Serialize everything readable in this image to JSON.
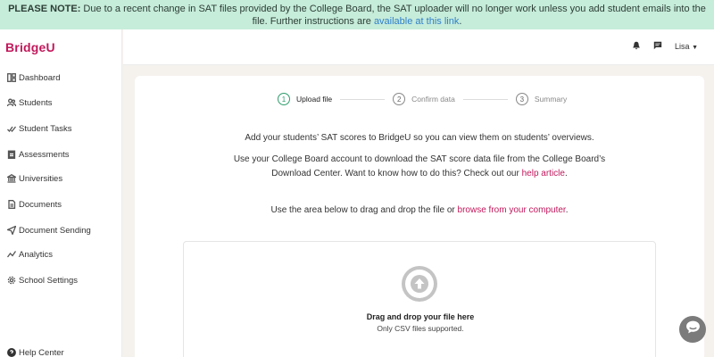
{
  "notice": {
    "label": "PLEASE NOTE:",
    "text": " Due to a recent change in SAT files provided by the College Board, the SAT uploader will no longer work unless you add student emails into the file. Further instructions are ",
    "link": "available at this link",
    "end": "."
  },
  "brand": {
    "logo": "BridgeU",
    "color": "#c2185b"
  },
  "sidebar": {
    "items": [
      {
        "label": "Dashboard",
        "icon": "dashboard-icon"
      },
      {
        "label": "Students",
        "icon": "users-icon"
      },
      {
        "label": "Student Tasks",
        "icon": "check-icon"
      },
      {
        "label": "Assessments",
        "icon": "clipboard-icon"
      },
      {
        "label": "Universities",
        "icon": "university-icon"
      },
      {
        "label": "Documents",
        "icon": "document-icon"
      },
      {
        "label": "Document Sending",
        "icon": "send-icon"
      },
      {
        "label": "Analytics",
        "icon": "analytics-icon"
      },
      {
        "label": "School Settings",
        "icon": "gear-icon"
      }
    ],
    "help": "Help Center"
  },
  "topbar": {
    "user": "Lisa"
  },
  "steps": [
    {
      "num": "1",
      "label": "Upload file",
      "active": true
    },
    {
      "num": "2",
      "label": "Confirm data",
      "active": false
    },
    {
      "num": "3",
      "label": "Summary",
      "active": false
    }
  ],
  "copy": {
    "line1": "Add your students’ SAT scores to BridgeU so you can view them on students’ overviews.",
    "line2a": "Use your College Board account to download the SAT score data file from the College Board’s Download Center. Want to know how to do this? Check out our ",
    "line2_link": "help article",
    "line2_end": ".",
    "line3a": "Use the area below to drag and drop the file or ",
    "line3_link": "browse from your computer",
    "line3_end": "."
  },
  "dropzone": {
    "title": "Drag and drop your file here",
    "sub": "Only CSV files supported."
  },
  "colors": {
    "accent": "#c2185b",
    "active_step": "#2e9d6c",
    "notice_bg": "#c6ecda",
    "link_blue": "#2f7fc9"
  }
}
